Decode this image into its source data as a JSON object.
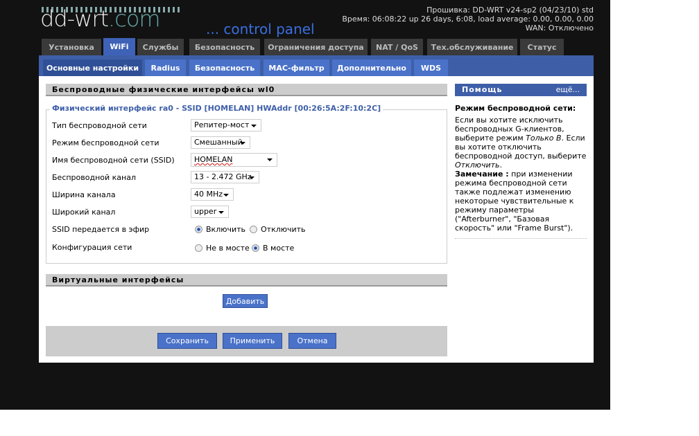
{
  "header": {
    "logo": "dd-wrt",
    "logo_suffix": ".com",
    "subtitle": "... control panel",
    "firmware": "Прошивка: DD-WRT v24-sp2 (04/23/10) std",
    "time": "Время: 06:08:22 up 26 days, 6:08, load average: 0.00, 0.00, 0.00",
    "wan": "WAN: Отключено"
  },
  "tabs": [
    "Установка",
    "WiFi",
    "Службы",
    "Безопасность",
    "Ограничения доступа",
    "NAT / QoS",
    "Тех.обслуживание",
    "Статус"
  ],
  "subtabs": [
    "Основные настройки",
    "Radius",
    "Безопасность",
    "MAC-фильтр",
    "Дополнительно",
    "WDS"
  ],
  "section": {
    "title": "Беспроводные физические интерфейсы wl0",
    "legend": "Физический интерфейс ra0 - SSID [HOMELAN] HWAddr [00:26:5A:2F:10:2C]"
  },
  "fields": {
    "type_label": "Тип беспроводной сети",
    "type_value": "Репитер-мост",
    "mode_label": "Режим беспроводной сети",
    "mode_value": "Смешанный",
    "ssid_label": "Имя беспроводной сети (SSID)",
    "ssid_value": "HOMELAN",
    "channel_label": "Беспроводной канал",
    "channel_value": "13 - 2.472 GHz",
    "width_label": "Ширина канала",
    "width_value": "40 MHz",
    "wide_label": "Широкий канал",
    "wide_value": "upper",
    "broadcast_label": "SSID передается в эфир",
    "broadcast_on": "Включить",
    "broadcast_off": "Отключить",
    "netconf_label": "Конфигурация сети",
    "netconf_unbridged": "Не в мосте",
    "netconf_bridged": "В мосте"
  },
  "virtual": {
    "title": "Виртуальные интерфейсы",
    "add": "Добавить"
  },
  "actions": {
    "save": "Сохранить",
    "apply": "Применить",
    "cancel": "Отмена"
  },
  "help": {
    "title": "Помощь",
    "more": "ещё...",
    "heading": "Режим беспроводной сети:",
    "p1": "Если вы хотите исключить беспроводных G-клиентов, выберите режим ",
    "p1_em": "Только B",
    "p2": ". Если вы хотите отключить беспроводной доступ, выберите ",
    "p2_em": "Отключить",
    "p3": ".",
    "note_label": "Замечание :",
    "note": " при изменении режима беспроводной сети также подлежат изменению некоторые чувствительные к режиму параметры (\"Afterburner\", \"Базовая скорость\" или \"Frame Burst\")."
  }
}
